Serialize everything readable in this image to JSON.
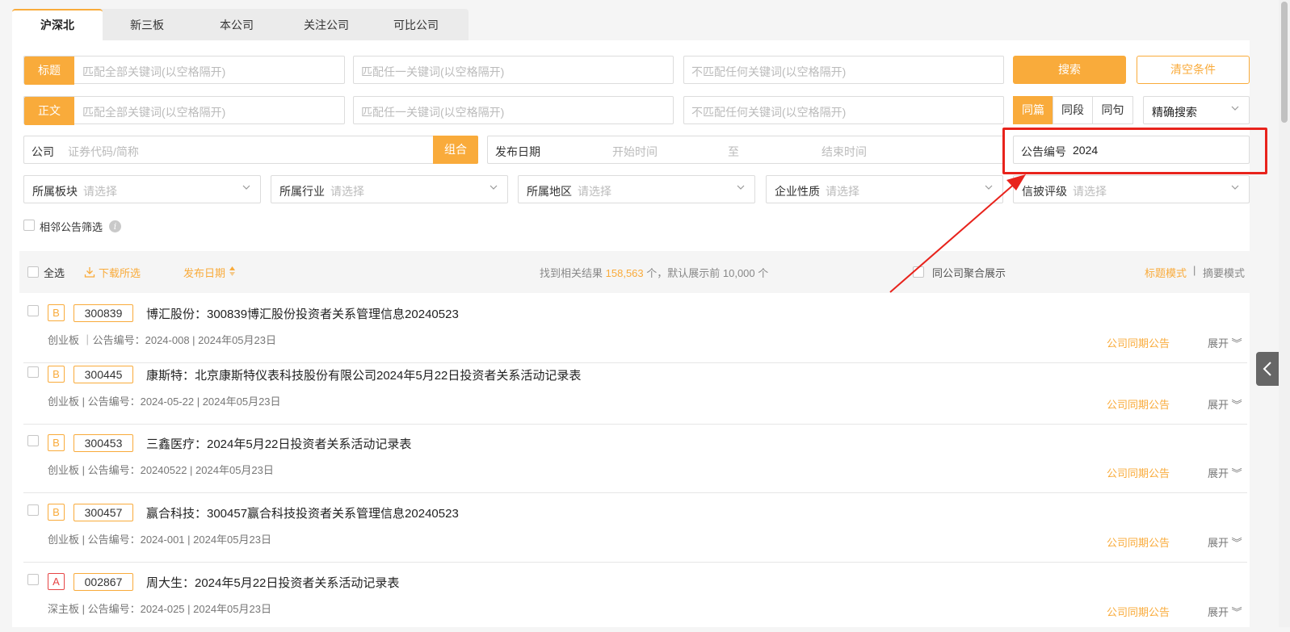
{
  "tabs": [
    "沪深北",
    "新三板",
    "本公司",
    "关注公司",
    "可比公司"
  ],
  "search": {
    "title_label": "标题",
    "body_label": "正文",
    "ph_all": "匹配全部关键词(以空格隔开)",
    "ph_any": "匹配任一关键词(以空格隔开)",
    "ph_none": "不匹配任何关键词(以空格隔开)",
    "search_btn": "搜索",
    "clear_btn": "清空条件",
    "scope": [
      "同篇",
      "同段",
      "同句"
    ],
    "mode_select": "精确搜索",
    "company_label": "公司",
    "company_ph": "证券代码/简称",
    "combo_btn": "组合",
    "date_label": "发布日期",
    "date_start_ph": "开始时间",
    "date_to": "至",
    "date_end_ph": "结束时间",
    "ann_no_label": "公告编号",
    "ann_no_value": "2024"
  },
  "filters": [
    {
      "name": "所属板块",
      "ph": "请选择"
    },
    {
      "name": "所属行业",
      "ph": "请选择"
    },
    {
      "name": "所属地区",
      "ph": "请选择"
    },
    {
      "name": "企业性质",
      "ph": "请选择"
    },
    {
      "name": "信披评级",
      "ph": "请选择"
    }
  ],
  "adjacent_filter": "相邻公告筛选",
  "results_bar": {
    "select_all": "全选",
    "download": "下载所选",
    "sort_label": "发布日期",
    "found_prefix": "找到相关结果",
    "found_count": "158,563",
    "found_suffix": "个，默认展示前 10,000 个",
    "group_label": "同公司聚合展示",
    "mode_title": "标题模式",
    "mode_sep": "|",
    "mode_summary": "摘要模式"
  },
  "results": [
    {
      "rank": "B",
      "code": "300839",
      "title": "博汇股份：300839博汇股份投资者关系管理信息20240523",
      "meta": "创业板 ｜公告编号：2024-008 | 2024年05月23日",
      "peer": "公司同期公告",
      "expand": "展开"
    },
    {
      "rank": "B",
      "code": "300445",
      "title": "康斯特：北京康斯特仪表科技股份有限公司2024年5月22日投资者关系活动记录表",
      "meta": "创业板 | 公告编号：2024-05-22 | 2024年05月23日",
      "peer": "公司同期公告",
      "expand": "展开"
    },
    {
      "rank": "B",
      "code": "300453",
      "title": "三鑫医疗：2024年5月22日投资者关系活动记录表",
      "meta": "创业板 | 公告编号：20240522 | 2024年05月23日",
      "peer": "公司同期公告",
      "expand": "展开"
    },
    {
      "rank": "B",
      "code": "300457",
      "title": "赢合科技：300457赢合科技投资者关系管理信息20240523",
      "meta": "创业板 | 公告编号：2024-001 | 2024年05月23日",
      "peer": "公司同期公告",
      "expand": "展开"
    },
    {
      "rank": "A",
      "code": "002867",
      "title": "周大生：2024年5月22日投资者关系活动记录表",
      "meta": "深主板 | 公告编号：2024-025 | 2024年05月23日",
      "peer": "公司同期公告",
      "expand": "展开"
    }
  ],
  "colors": {
    "accent": "#f9ab3b",
    "annotation": "#e8231c"
  }
}
